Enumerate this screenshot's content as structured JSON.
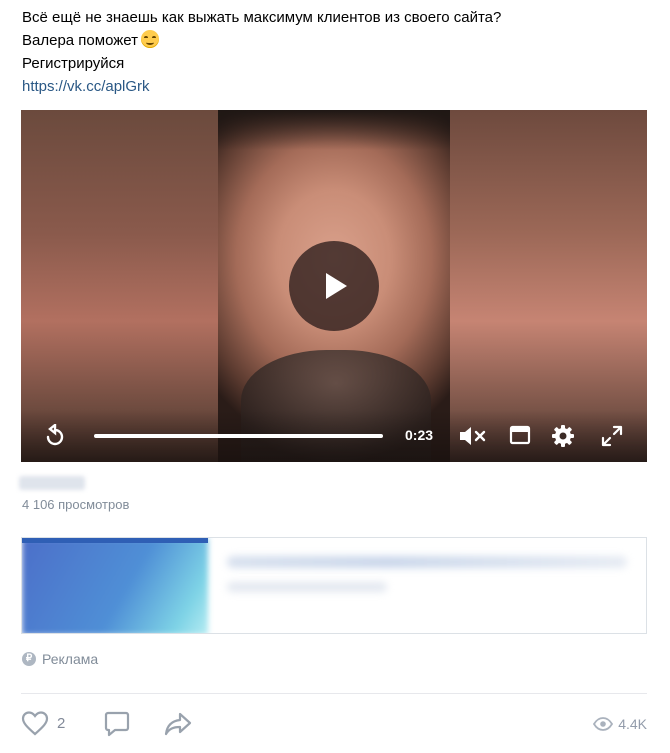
{
  "post": {
    "line1": "Всё ещё не знаешь как выжать максимум клиентов из своего сайта?",
    "line2": "Валера поможет",
    "line3": "Регистрируйся",
    "link": "https://vk.cc/aplGrk"
  },
  "video": {
    "time": "0:23",
    "progress": 1.0
  },
  "stats": {
    "views_text": "4 106 просмотров"
  },
  "ad": {
    "label": "Реклама",
    "icon_glyph": "₽"
  },
  "actions": {
    "likes": "2",
    "views": "4.4K"
  },
  "colors": {
    "link": "#2a5885",
    "muted": "#818c99",
    "icon": "#99a2ad"
  }
}
